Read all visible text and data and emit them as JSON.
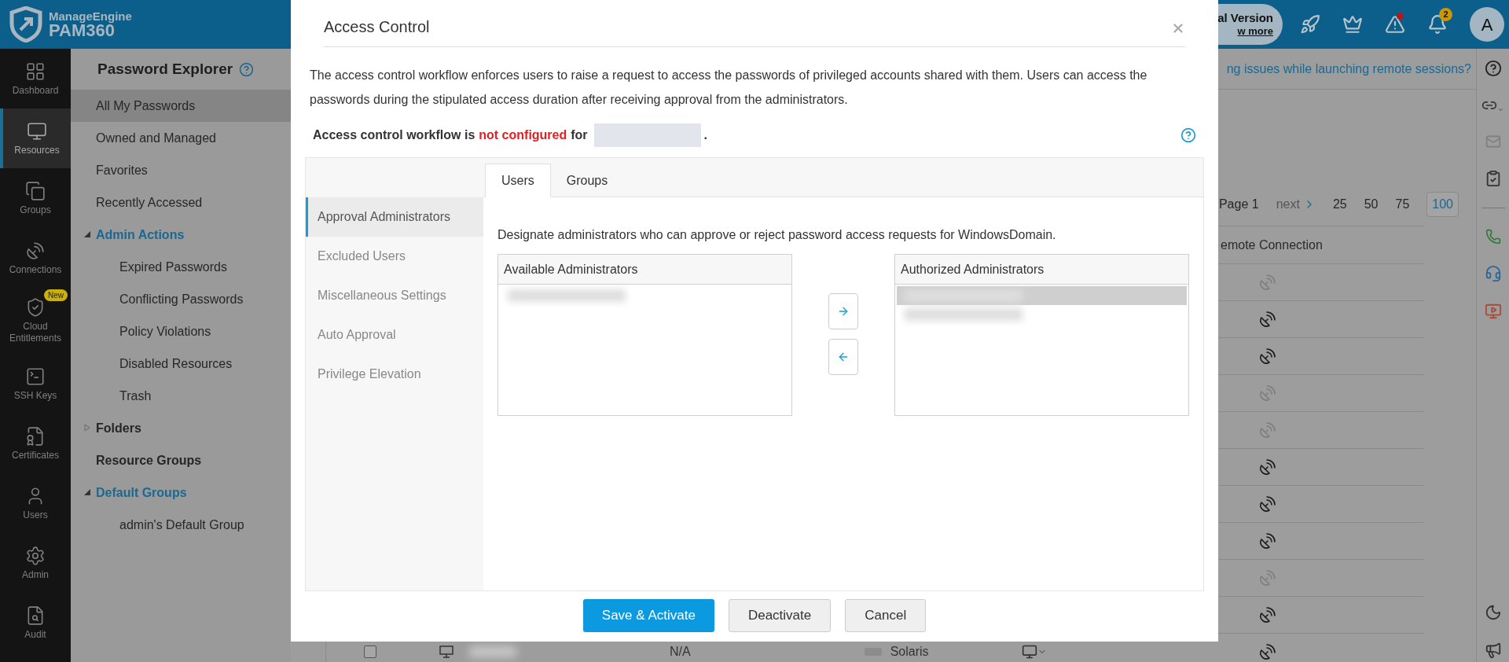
{
  "header": {
    "brand": "ManageEngine",
    "product": "PAM360",
    "trial": {
      "line_1": "al Version",
      "line_2": "w more"
    },
    "notification_count": "2",
    "avatar": "A"
  },
  "nav_rail": [
    {
      "label": "Dashboard",
      "selected": false
    },
    {
      "label": "Resources",
      "selected": true
    },
    {
      "label": "Groups",
      "selected": false
    },
    {
      "label": "Connections",
      "selected": false
    },
    {
      "label": "Cloud Entitlements",
      "selected": false,
      "badge": "New"
    },
    {
      "label": "SSH Keys",
      "selected": false
    },
    {
      "label": "Certificates",
      "selected": false
    },
    {
      "label": "Users",
      "selected": false
    },
    {
      "label": "Admin",
      "selected": false
    },
    {
      "label": "Audit",
      "selected": false
    }
  ],
  "explorer": {
    "title": "Password Explorer",
    "items": [
      {
        "kind": "link",
        "label": "All My Passwords",
        "selected": true
      },
      {
        "kind": "link",
        "label": "Owned and Managed",
        "selected": false
      },
      {
        "kind": "link",
        "label": "Favorites",
        "selected": false
      },
      {
        "kind": "link",
        "label": "Recently Accessed",
        "selected": false
      },
      {
        "kind": "folder",
        "label": "Admin Actions",
        "expanded": true,
        "children": [
          {
            "kind": "link",
            "label": "Expired Passwords",
            "selected": false
          },
          {
            "kind": "link",
            "label": "Conflicting Passwords",
            "selected": false
          },
          {
            "kind": "link",
            "label": "Policy Violations",
            "selected": false
          },
          {
            "kind": "link",
            "label": "Disabled Resources",
            "selected": false
          },
          {
            "kind": "link",
            "label": "Trash",
            "selected": false
          }
        ]
      },
      {
        "kind": "folder",
        "label": "Folders",
        "expanded": false
      },
      {
        "kind": "heading",
        "label": "Resource Groups"
      },
      {
        "kind": "folder",
        "label": "Default Groups",
        "expanded": true,
        "children": [
          {
            "kind": "link",
            "label": "admin's Default Group",
            "selected": false
          }
        ]
      }
    ]
  },
  "main": {
    "banner_link": "ng issues while launching remote sessions?",
    "pagination": {
      "page": "Page 1",
      "next": "next",
      "sizes": [
        {
          "label": "25",
          "selected": false
        },
        {
          "label": "50",
          "selected": false
        },
        {
          "label": "75",
          "selected": false
        },
        {
          "label": "100",
          "selected": true
        }
      ]
    },
    "column": "emote Connection",
    "rows": [
      {
        "enabled": false
      },
      {
        "enabled": true
      },
      {
        "enabled": true
      },
      {
        "enabled": false
      },
      {
        "enabled": false
      },
      {
        "enabled": true
      },
      {
        "enabled": true
      },
      {
        "enabled": true
      },
      {
        "enabled": false
      },
      {
        "enabled": true
      },
      {
        "enabled": true
      }
    ],
    "last_row": {
      "checked": false,
      "column_3": "N/A",
      "os": "Solaris"
    }
  },
  "modal": {
    "title": "Access Control",
    "description": "The access control workflow enforces users to raise a request to access the passwords of privileged accounts shared with them. Users can access the passwords during the stipulated access duration after receiving approval from the administrators.",
    "status": {
      "prefix": "Access control workflow is",
      "state": "not configured",
      "suffix": "for",
      "end": "."
    },
    "side_nav": [
      {
        "label": "Approval Administrators",
        "selected": true
      },
      {
        "label": "Excluded Users",
        "selected": false
      },
      {
        "label": "Miscellaneous Settings",
        "selected": false
      },
      {
        "label": "Auto Approval",
        "selected": false
      },
      {
        "label": "Privilege Elevation",
        "selected": false
      }
    ],
    "tabs": [
      {
        "label": "Users",
        "selected": true
      },
      {
        "label": "Groups",
        "selected": false
      }
    ],
    "instruction": "Designate administrators who can approve or reject password access requests for WindowsDomain.",
    "available": {
      "title": "Available Administrators",
      "entries": [
        {
          "selected": false
        }
      ]
    },
    "authorized": {
      "title": "Authorized Administrators",
      "entries": [
        {
          "selected": true
        },
        {
          "selected": false
        }
      ]
    },
    "buttons": [
      {
        "label": "Save & Activate",
        "kind": "primary"
      },
      {
        "label": "Deactivate",
        "kind": "secondary"
      },
      {
        "label": "Cancel",
        "kind": "secondary"
      }
    ]
  }
}
